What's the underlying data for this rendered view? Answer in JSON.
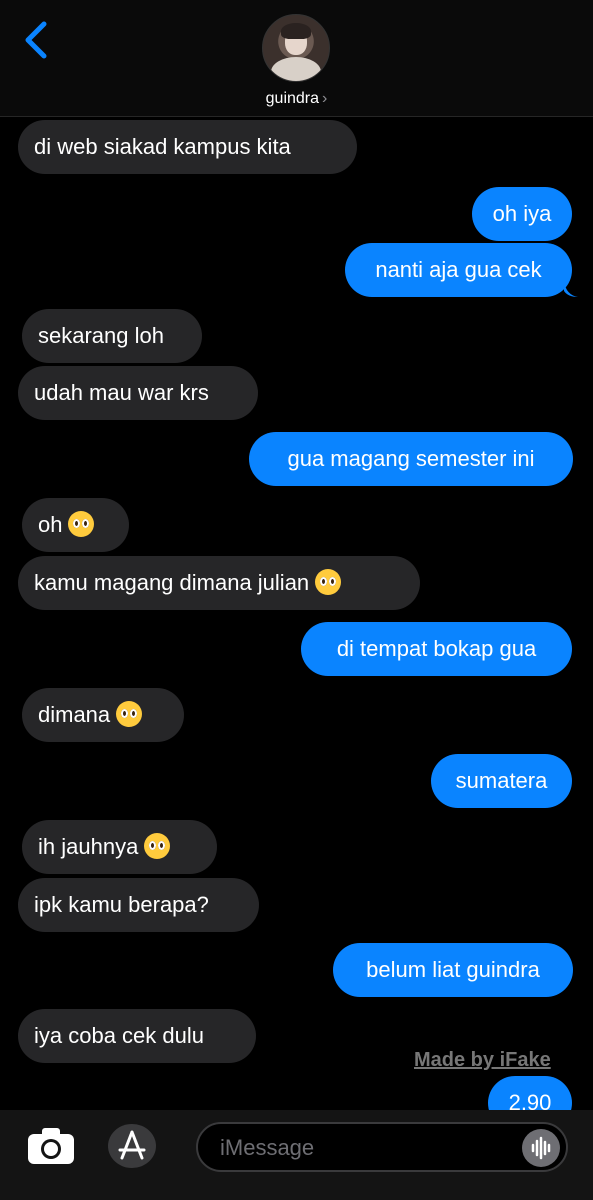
{
  "header": {
    "contact_name": "guindra",
    "chevron": "›"
  },
  "messages": [
    {
      "side": "in",
      "text": "di web siakad kampus kita",
      "emoji": false
    },
    {
      "side": "out",
      "text": "oh iya",
      "emoji": false
    },
    {
      "side": "out",
      "text": "nanti aja gua cek",
      "emoji": false
    },
    {
      "side": "in",
      "text": "sekarang loh",
      "emoji": false
    },
    {
      "side": "in",
      "text": "udah mau war krs",
      "emoji": false
    },
    {
      "side": "out",
      "text": "gua magang semester ini",
      "emoji": false
    },
    {
      "side": "in",
      "text": "oh",
      "emoji": true
    },
    {
      "side": "in",
      "text": "kamu magang dimana julian",
      "emoji": true
    },
    {
      "side": "out",
      "text": "di tempat bokap gua",
      "emoji": false
    },
    {
      "side": "in",
      "text": "dimana",
      "emoji": true
    },
    {
      "side": "out",
      "text": "sumatera",
      "emoji": false
    },
    {
      "side": "in",
      "text": "ih jauhnya",
      "emoji": true
    },
    {
      "side": "in",
      "text": "ipk kamu berapa?",
      "emoji": false
    },
    {
      "side": "out",
      "text": "belum liat guindra",
      "emoji": false
    },
    {
      "side": "in",
      "text": "iya coba cek dulu",
      "emoji": false
    },
    {
      "side": "out",
      "text": "2.90",
      "emoji": false
    }
  ],
  "watermark": "Made by iFake",
  "composer": {
    "placeholder": "iMessage"
  },
  "colors": {
    "outgoing": "#0a84ff",
    "incoming": "#262628",
    "accent": "#0a84ff"
  },
  "icons": [
    "back-chevron-icon",
    "camera-icon",
    "app-store-icon",
    "audio-waveform-icon",
    "pleading-face-emoji"
  ]
}
